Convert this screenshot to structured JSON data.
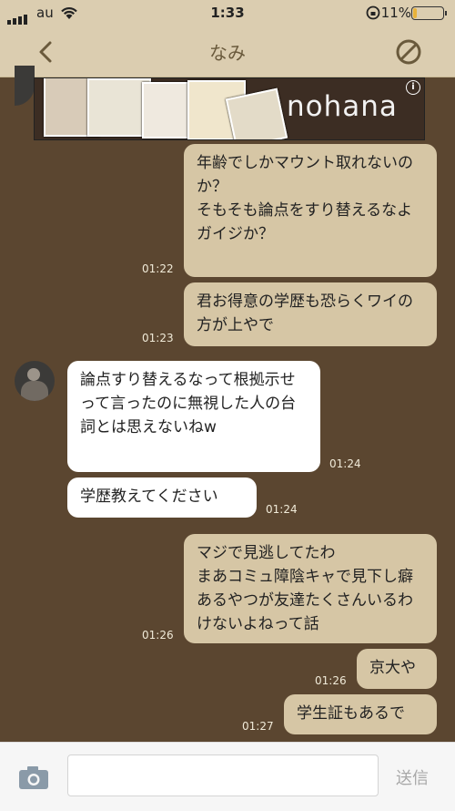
{
  "status": {
    "carrier": "au",
    "time": "1:33",
    "battery_text": "11%",
    "battery_level": 0.11
  },
  "nav": {
    "title": "なみ"
  },
  "ad": {
    "brand": "nohana",
    "info": "i"
  },
  "messages": [
    {
      "side": "mine",
      "text": "年齢でしかマウント取れないのか？\nそもそも論点をすり替えるなよ\nガイジか？",
      "time": "01:22"
    },
    {
      "side": "mine",
      "text": "君お得意の学歴も恐らくワイの方が上やで",
      "time": "01:23"
    },
    {
      "side": "theirs",
      "text": "論点すり替えるなって根拠示せって言ったのに無視した人の台詞とは思えないねw",
      "time": "01:24"
    },
    {
      "side": "theirs",
      "text": "学歴教えてください",
      "time": "01:24"
    },
    {
      "side": "mine",
      "text": "マジで見逃してたわ\nまあコミュ障陰キャで見下し癖あるやつが友達たくさんいるわけないよねって話",
      "time": "01:26"
    },
    {
      "side": "mine",
      "text": "京大や",
      "time": "01:26"
    },
    {
      "side": "mine",
      "text": "学生証もあるで",
      "time": "01:27"
    }
  ],
  "input": {
    "placeholder": "",
    "send_label": "送信"
  }
}
